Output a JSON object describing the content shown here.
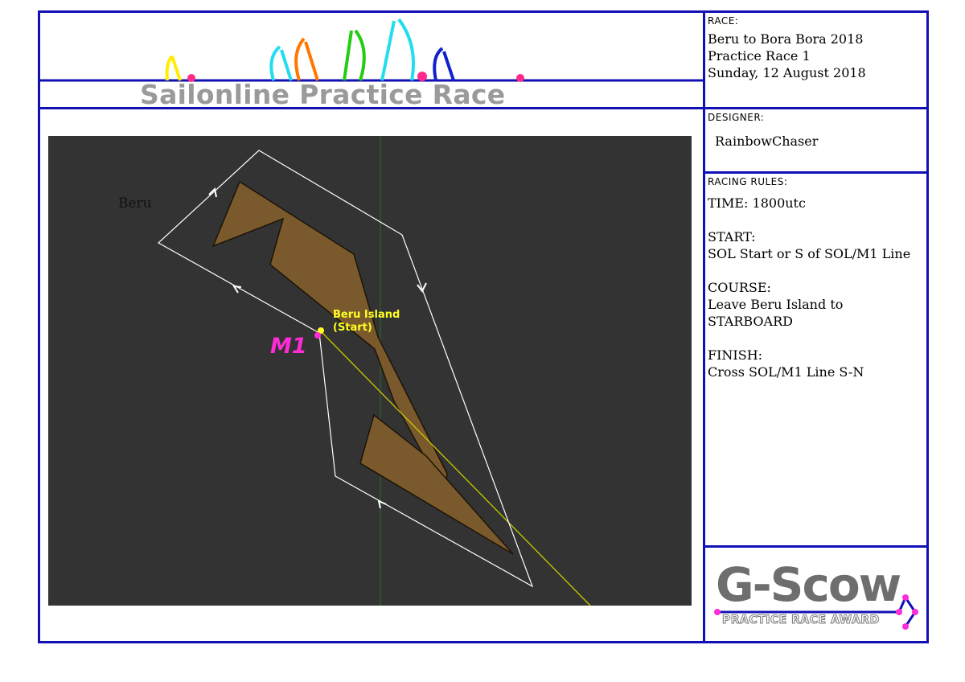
{
  "banner": {
    "title": "Sailonline Practice Race",
    "sail_colors": [
      "#ffee00",
      "#22ddee",
      "#ff7700",
      "#22cc11",
      "#22ddee",
      "#1122cc"
    ],
    "dot_color": "#ff2a8a"
  },
  "race": {
    "heading": "RACE:",
    "lines": "Beru to Bora Bora 2018\nPractice Race 1\nSunday, 12 August 2018"
  },
  "designer": {
    "heading": "DESIGNER:",
    "name": "RainbowChaser"
  },
  "rules": {
    "heading": "RACING RULES:",
    "time": "TIME: 1800utc",
    "start_label": "START:",
    "start_text": "SOL Start or S of SOL/M1 Line",
    "course_label": "COURSE:",
    "course_text": "Leave Beru Island to\nSTARBOARD",
    "finish_label": "FINISH:",
    "finish_text": "Cross SOL/M1 Line S-N"
  },
  "map": {
    "island_name": "Beru",
    "start_label": "Beru Island\n(Start)",
    "mark_label": "M1",
    "colors": {
      "water": "#333333",
      "land": "#7a5a2c",
      "course_line": "#ffffff",
      "start_line": "#c8c800",
      "meridian": "#2d6b2d",
      "start_point": "#ffff22",
      "mark": "#ff2bd6"
    }
  },
  "award": {
    "big": "G-Scow",
    "small": "PRACTICE RACE AWARD"
  },
  "colors": {
    "frame": "#1010b4"
  }
}
